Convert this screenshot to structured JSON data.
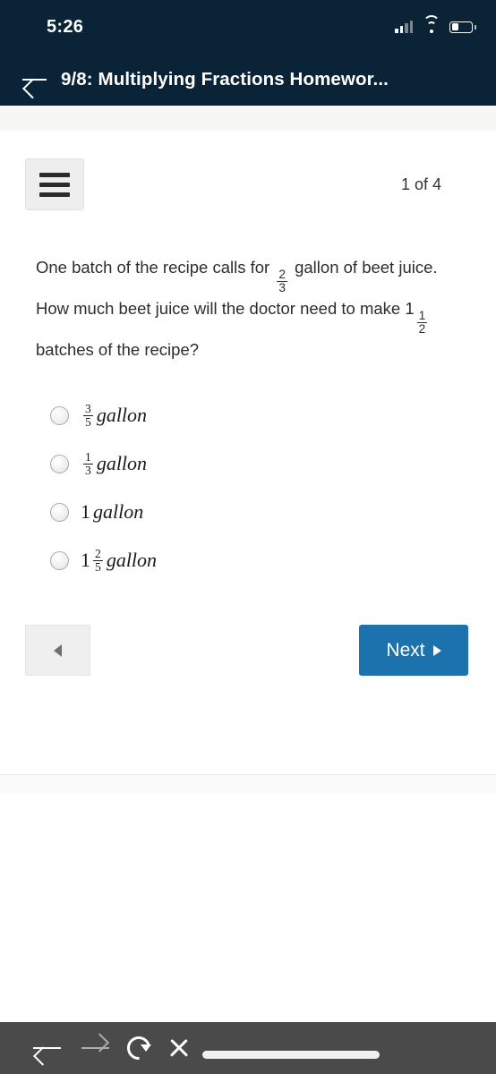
{
  "status_bar": {
    "time": "5:26",
    "signal_icon": "cellular-signal-icon",
    "wifi_icon": "wifi-icon",
    "battery_icon": "battery-icon"
  },
  "header": {
    "back_icon": "back-arrow-icon",
    "title": "9/8: Multiplying Fractions Homewor..."
  },
  "toolbar": {
    "menu_icon": "hamburger-menu-icon",
    "counter": "1 of 4"
  },
  "question": {
    "part1": "One batch of the recipe calls for",
    "fraction1": {
      "numerator": "2",
      "denominator": "3"
    },
    "part2": "gallon of beet juice. How much beet juice will the doctor need to make",
    "whole2": "1",
    "fraction2": {
      "numerator": "1",
      "denominator": "2"
    },
    "part3": "batches of the recipe?"
  },
  "options": [
    {
      "whole": "",
      "numerator": "3",
      "denominator": "5",
      "unit": "gallon",
      "selected": false
    },
    {
      "whole": "",
      "numerator": "1",
      "denominator": "3",
      "unit": "gallon",
      "selected": false
    },
    {
      "whole": "1",
      "numerator": "",
      "denominator": "",
      "unit": "gallon",
      "selected": false
    },
    {
      "whole": "1",
      "numerator": "2",
      "denominator": "5",
      "unit": "gallon",
      "selected": false
    }
  ],
  "navigation": {
    "prev_icon": "triangle-left-icon",
    "next_label": "Next",
    "next_icon": "triangle-right-icon"
  },
  "browser_bar": {
    "back_icon": "browser-back-arrow-icon",
    "forward_icon": "browser-forward-arrow-icon",
    "reload_icon": "reload-icon",
    "stop_icon": "stop-x-icon",
    "url_bar": "url-progress-bar"
  },
  "colors": {
    "header_bg": "#0a2336",
    "next_button": "#1b72ad",
    "browser_bar": "#4a4a4a",
    "button_gray": "#eeeeee"
  }
}
